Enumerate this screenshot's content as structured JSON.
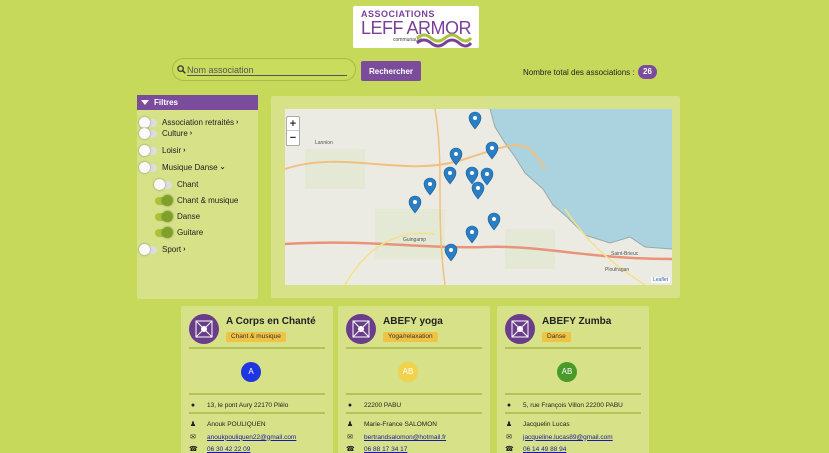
{
  "logo": {
    "line1": "ASSOCIATIONS",
    "line2": "LEFF ARMOR",
    "line3": "communauté"
  },
  "search": {
    "placeholder": "Nom association",
    "button": "Rechercher"
  },
  "total": {
    "label": "Nombre total des associations :",
    "count": "26"
  },
  "filters": {
    "title": "Filtres",
    "items": [
      {
        "label": "Association retraités",
        "on": false,
        "level": 0,
        "caret": "›"
      },
      {
        "label": "Culture",
        "on": false,
        "level": 0,
        "caret": "›"
      },
      {
        "label": "Loisir",
        "on": false,
        "level": 0,
        "caret": "›"
      },
      {
        "label": "Musique Danse",
        "on": false,
        "level": 0,
        "caret": "⌄"
      },
      {
        "label": "Chant",
        "on": false,
        "level": 1,
        "caret": ""
      },
      {
        "label": "Chant & musique",
        "on": true,
        "level": 1,
        "caret": ""
      },
      {
        "label": "Danse",
        "on": true,
        "level": 1,
        "caret": ""
      },
      {
        "label": "Guitare",
        "on": true,
        "level": 1,
        "caret": ""
      },
      {
        "label": "Sport",
        "on": false,
        "level": 0,
        "caret": "›"
      }
    ]
  },
  "map": {
    "zoom_in": "+",
    "zoom_out": "−",
    "attribution": "Leaflet",
    "places": [
      "Lannion",
      "Guingamp",
      "Saint-Brieuc",
      "Ploufragan"
    ],
    "marker_color": "#2a7fc4",
    "sea_color": "#aad3df"
  },
  "cards": [
    {
      "name": "A Corps en Chanté",
      "tag": "Chant & musique",
      "initial": "A",
      "initial_color": "#1f35e0",
      "address": "13, le pont Aury 22170 Plélo",
      "contact": "Anouk POULIQUEN",
      "email": "anoukpouliquen22@gmail.com",
      "phone": "06 30 42 22 09"
    },
    {
      "name": "ABEFY yoga",
      "tag": "Yoga/relaxation",
      "initial": "AB",
      "initial_color": "#f2d24a",
      "address": "22200 PABU",
      "contact": "Marie-France SALOMON",
      "email": "bertrandsalomon@hotmail.fr",
      "phone": "06 88 17 34 17"
    },
    {
      "name": "ABEFY Zumba",
      "tag": "Danse",
      "initial": "AB",
      "initial_color": "#4a9a2a",
      "address": "5, rue François Villon 22200 PABU",
      "contact": "Jacquelin Lucas",
      "email": "jacqueline.lucas89@gmail.com",
      "phone": "06 14 49 88 94"
    }
  ]
}
